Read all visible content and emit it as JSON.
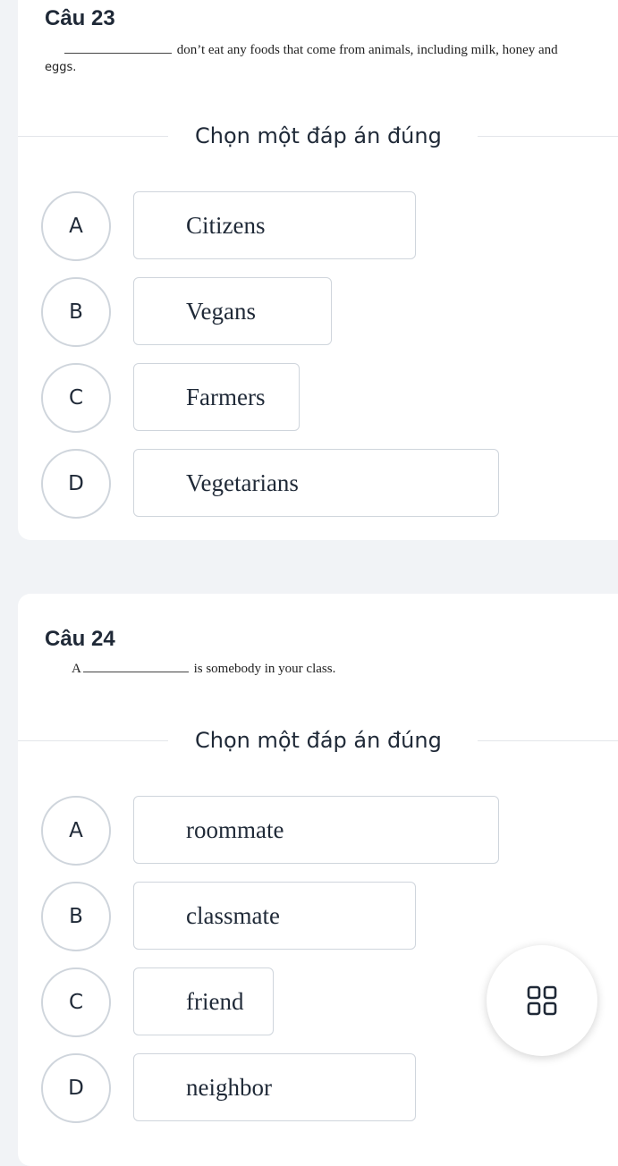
{
  "questions": [
    {
      "title": "Câu 23",
      "text_before_blank": "",
      "text_after_blank": "don’t eat any foods that come from animals, including milk, honey and",
      "text_line2": "eggs.",
      "instruction": "Chọn một đáp án đúng",
      "options": [
        {
          "letter": "A",
          "text": "Citizens"
        },
        {
          "letter": "B",
          "text": "Vegans"
        },
        {
          "letter": "C",
          "text": "Farmers"
        },
        {
          "letter": "D",
          "text": "Vegetarians"
        }
      ]
    },
    {
      "title": "Câu 24",
      "text_before_blank": "A",
      "text_after_blank": "is somebody in your class.",
      "instruction": "Chọn một đáp án đúng",
      "options": [
        {
          "letter": "A",
          "text": "roommate"
        },
        {
          "letter": "B",
          "text": "classmate"
        },
        {
          "letter": "C",
          "text": "friend"
        },
        {
          "letter": "D",
          "text": "neighbor"
        }
      ]
    }
  ],
  "fab": {
    "icon": "grid-icon"
  }
}
